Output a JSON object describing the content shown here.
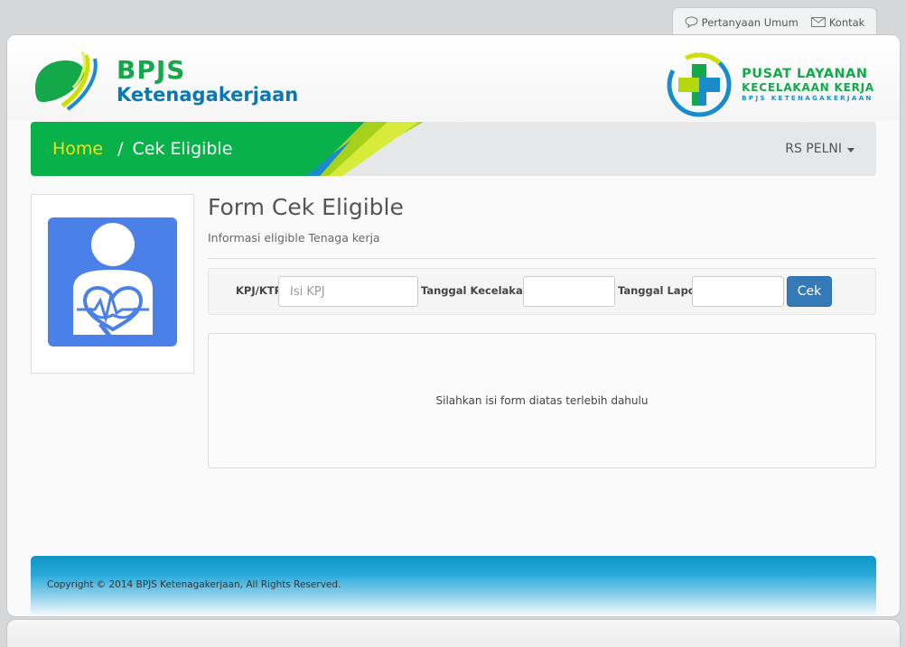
{
  "top_links": {
    "faq": "Pertanyaan Umum",
    "contact": "Kontak"
  },
  "brand": {
    "name_line1": "BPJS",
    "name_line2": "Ketenagakerjaan"
  },
  "service_logo": {
    "line1": "PUSAT LAYANAN",
    "line2": "KECELAKAAN KERJA",
    "line3": "BPJS KETENAGAKERJAAN"
  },
  "breadcrumb": {
    "home": "Home",
    "separator": "/",
    "current": "Cek Eligible"
  },
  "user_menu": {
    "label": "RS PELNI"
  },
  "form": {
    "title": "Form Cek Eligible",
    "subtitle": "Informasi eligible Tenaga kerja",
    "kpj_label": "KPJ/KTP",
    "kpj_placeholder": "Isi KPJ",
    "accident_date_label": "Tanggal Kecelakaan",
    "report_date_label": "Tanggal Lapor",
    "submit_label": "Cek"
  },
  "result": {
    "message": "Silahkan isi form diatas terlebih dahulu"
  },
  "footer": {
    "copyright": "Copyright © 2014 BPJS Ketenagakerjaan, All Rights Reserved."
  },
  "colors": {
    "brand_green": "#14a84a",
    "brand_blue": "#0b78b4",
    "home_link": "#f6e30c",
    "button": "#337ab7"
  }
}
